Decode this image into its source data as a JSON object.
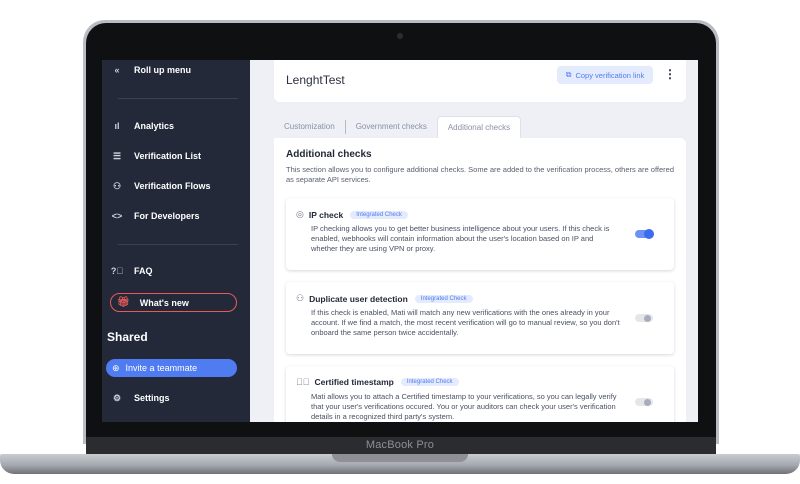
{
  "device": {
    "label": "MacBook Pro"
  },
  "sidebar": {
    "collapse_label": "Roll up menu",
    "collapse_icon": "chevron-double-left-icon",
    "items": [
      {
        "label": "Analytics",
        "icon": "bar-chart-icon"
      },
      {
        "label": "Verification List",
        "icon": "list-icon"
      },
      {
        "label": "Verification Flows",
        "icon": "users-flow-icon"
      },
      {
        "label": "For Developers",
        "icon": "code-icon"
      }
    ],
    "faq_label": "FAQ",
    "whats_new_label": "What's new",
    "shared_title": "Shared",
    "invite_label": "Invite a teammate",
    "settings_label": "Settings"
  },
  "header": {
    "flow_name": "LenghtTest",
    "copy_link_label": "Copy verification link",
    "more_icon": "more-vertical-icon"
  },
  "tabs": [
    {
      "label": "Customization",
      "active": false
    },
    {
      "label": "Government checks",
      "active": false
    },
    {
      "label": "Additional checks",
      "active": true
    }
  ],
  "panel": {
    "title": "Additional checks",
    "description": "This section allows you to configure additional checks. Some are added to the verification process, others are offered as separate API services."
  },
  "checks": [
    {
      "title": "IP check",
      "badge": "Integrated Check",
      "icon": "location-pin-icon",
      "text": "IP checking allows you to get better business intelligence about your users. If this check is enabled, webhooks will contain information about the user's location based on IP and whether they are using VPN or proxy.",
      "enabled": true
    },
    {
      "title": "Duplicate user detection",
      "badge": "Integrated Check",
      "icon": "users-icon",
      "text": "If this check is enabled, Mati will match any new verifications with the ones already in your account. If we find a match, the most recent verification will go to manual review, so you don't onboard the same person twice accidentally.",
      "enabled": false
    },
    {
      "title": "Certified timestamp",
      "badge": "Integrated Check",
      "icon": "check-circle-icon",
      "text": "Mati allows you to attach a Certified timestamp to your verifications, so you can legally verify that your user's verifications occured. You or your auditors can check your user's verification details in a recognized third party's system.",
      "enabled": false
    }
  ],
  "colors": {
    "sidebar_bg": "#232939",
    "accent": "#507cf2",
    "whats_new_border": "#e85a5a",
    "page_bg": "#eef0f6"
  }
}
